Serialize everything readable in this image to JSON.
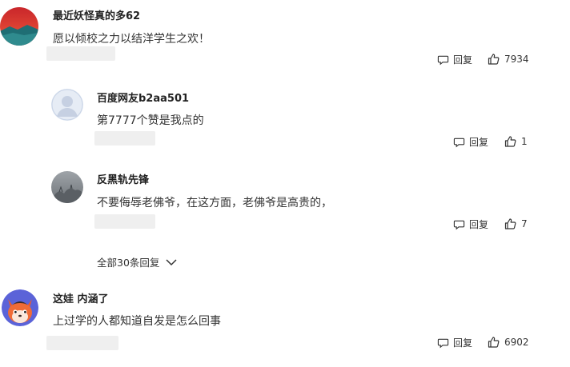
{
  "comments": [
    {
      "author": "最近妖怪真的多62",
      "text": "愿以倾校之力以结洋学生之欢！",
      "reply_label": "回复",
      "likes": "7934"
    },
    {
      "author": "百度网友b2aa501",
      "text": "第7777个赞是我点的",
      "reply_label": "回复",
      "likes": "1"
    },
    {
      "author": "反黑轨先锋",
      "text": "不要侮辱老佛爷，在这方面，老佛爷是高贵的，",
      "reply_label": "回复",
      "likes": "7"
    },
    {
      "author": "这娃 内涵了",
      "text": "上过学的人都知道自发是怎么回事",
      "reply_label": "回复",
      "likes": "6902"
    }
  ],
  "replies_toggle": {
    "label": "全部30条回复"
  }
}
